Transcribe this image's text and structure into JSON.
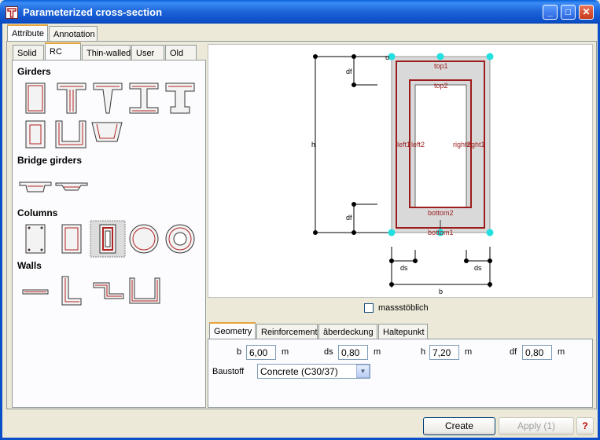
{
  "window": {
    "title": "Parameterized cross-section"
  },
  "top_tabs": [
    "Attribute",
    "Annotation"
  ],
  "category_tabs": [
    "Solid",
    "RC",
    "Thin-walled",
    "User",
    "Old"
  ],
  "sections": {
    "girders": "Girders",
    "bridge_girders": "Bridge girders",
    "columns": "Columns",
    "walls": "Walls"
  },
  "diagram_labels": {
    "top1": "top1",
    "top2": "top2",
    "left1": "left1",
    "left2": "left2",
    "right2": "right2",
    "right1": "right1",
    "bottom2": "bottom2",
    "bottom1": "bottom1",
    "df": "df",
    "h": "h",
    "ds": "ds",
    "b": "b",
    "u": "u"
  },
  "scale_checkbox": {
    "label": "massstöblich",
    "checked": false
  },
  "bottom_tabs": [
    "Geometry",
    "Reinforcement",
    "âberdeckung",
    "Haltepunkt"
  ],
  "geometry": {
    "b": {
      "label": "b",
      "value": "6,00",
      "unit": "m"
    },
    "ds": {
      "label": "ds",
      "value": "0,80",
      "unit": "m"
    },
    "h": {
      "label": "h",
      "value": "7,20",
      "unit": "m"
    },
    "df": {
      "label": "df",
      "value": "0,80",
      "unit": "m"
    },
    "material_label": "Baustoff",
    "material_value": "Concrete (C30/37)"
  },
  "buttons": {
    "create": "Create",
    "apply": "Apply (1)",
    "help": "?"
  },
  "colors": {
    "accent": "#e6a43c",
    "section_line": "#9b1c1c",
    "handle": "#22e0e0",
    "title_bar": "#0a5fd8"
  }
}
